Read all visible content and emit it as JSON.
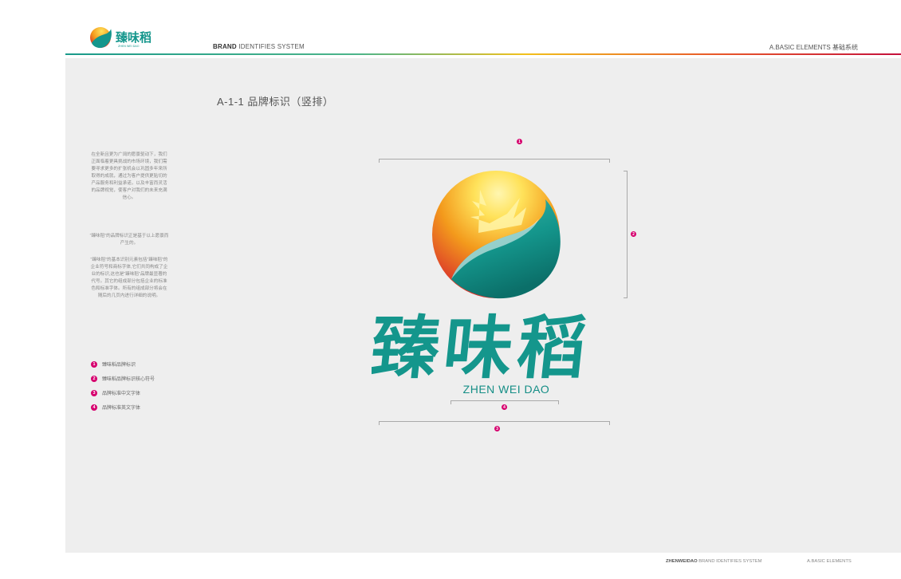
{
  "header": {
    "brand_name": "臻味稻",
    "logo_caption": "ZHEN WEI DAO",
    "system_bold": "BRAND",
    "system_rest": " IDENTIFIES SYSTEM",
    "section": "A.BASIC ELEMENTS  基础系统"
  },
  "page": {
    "heading": "A-1-1  品牌标识（竖排）"
  },
  "description": {
    "paragraph_1": "在全新且更为广阔的愿景驱动下，我们正面临着更具挑战的市场环境，我们需要寻求更多的扩张机会以巩固多年来所取得的成就，通过为客户提供更贴切的产品服务和利益承诺，以及丰富而灵活的品牌视觉，使客户对我们的未来充满信心。",
    "paragraph_2": "“臻味稻”的品牌标识正是基于以上愿景而产生的。",
    "paragraph_3": "“臻味稻”的基本识别元素包括“臻味稻”的企业符号和商标字体,它们共同构成了企业的标识,这也是“臻味稻”品牌最显著的代号。其它的组成部分包括企业的标准色和标准字体。所有的组成部分将会在随后的几页内进行详细的说明。"
  },
  "legend": [
    {
      "number": "1",
      "label": "臻味稻品牌标识"
    },
    {
      "number": "2",
      "label": "臻味稻品牌标识核心符号"
    },
    {
      "number": "3",
      "label": "品牌标准中文字体"
    },
    {
      "number": "4",
      "label": "品牌标准英文字体"
    }
  ],
  "markers": {
    "m1": "1",
    "m2": "2",
    "m3": "3",
    "m4": "4"
  },
  "logo": {
    "chinese_name": "臻味稻",
    "english_name": "ZHEN WEI DAO",
    "colors": {
      "teal": "#14968c",
      "teal_dark": "#0b6f69",
      "yellow": "#ffe25a",
      "orange": "#f39a1c",
      "red": "#d7262c"
    }
  },
  "footer": {
    "left_bold": "ZHENWEIDAO",
    "left_rest": " BRAND IDENTIFIES SYSTEM",
    "right": "A.BASIC ELEMENTS"
  }
}
